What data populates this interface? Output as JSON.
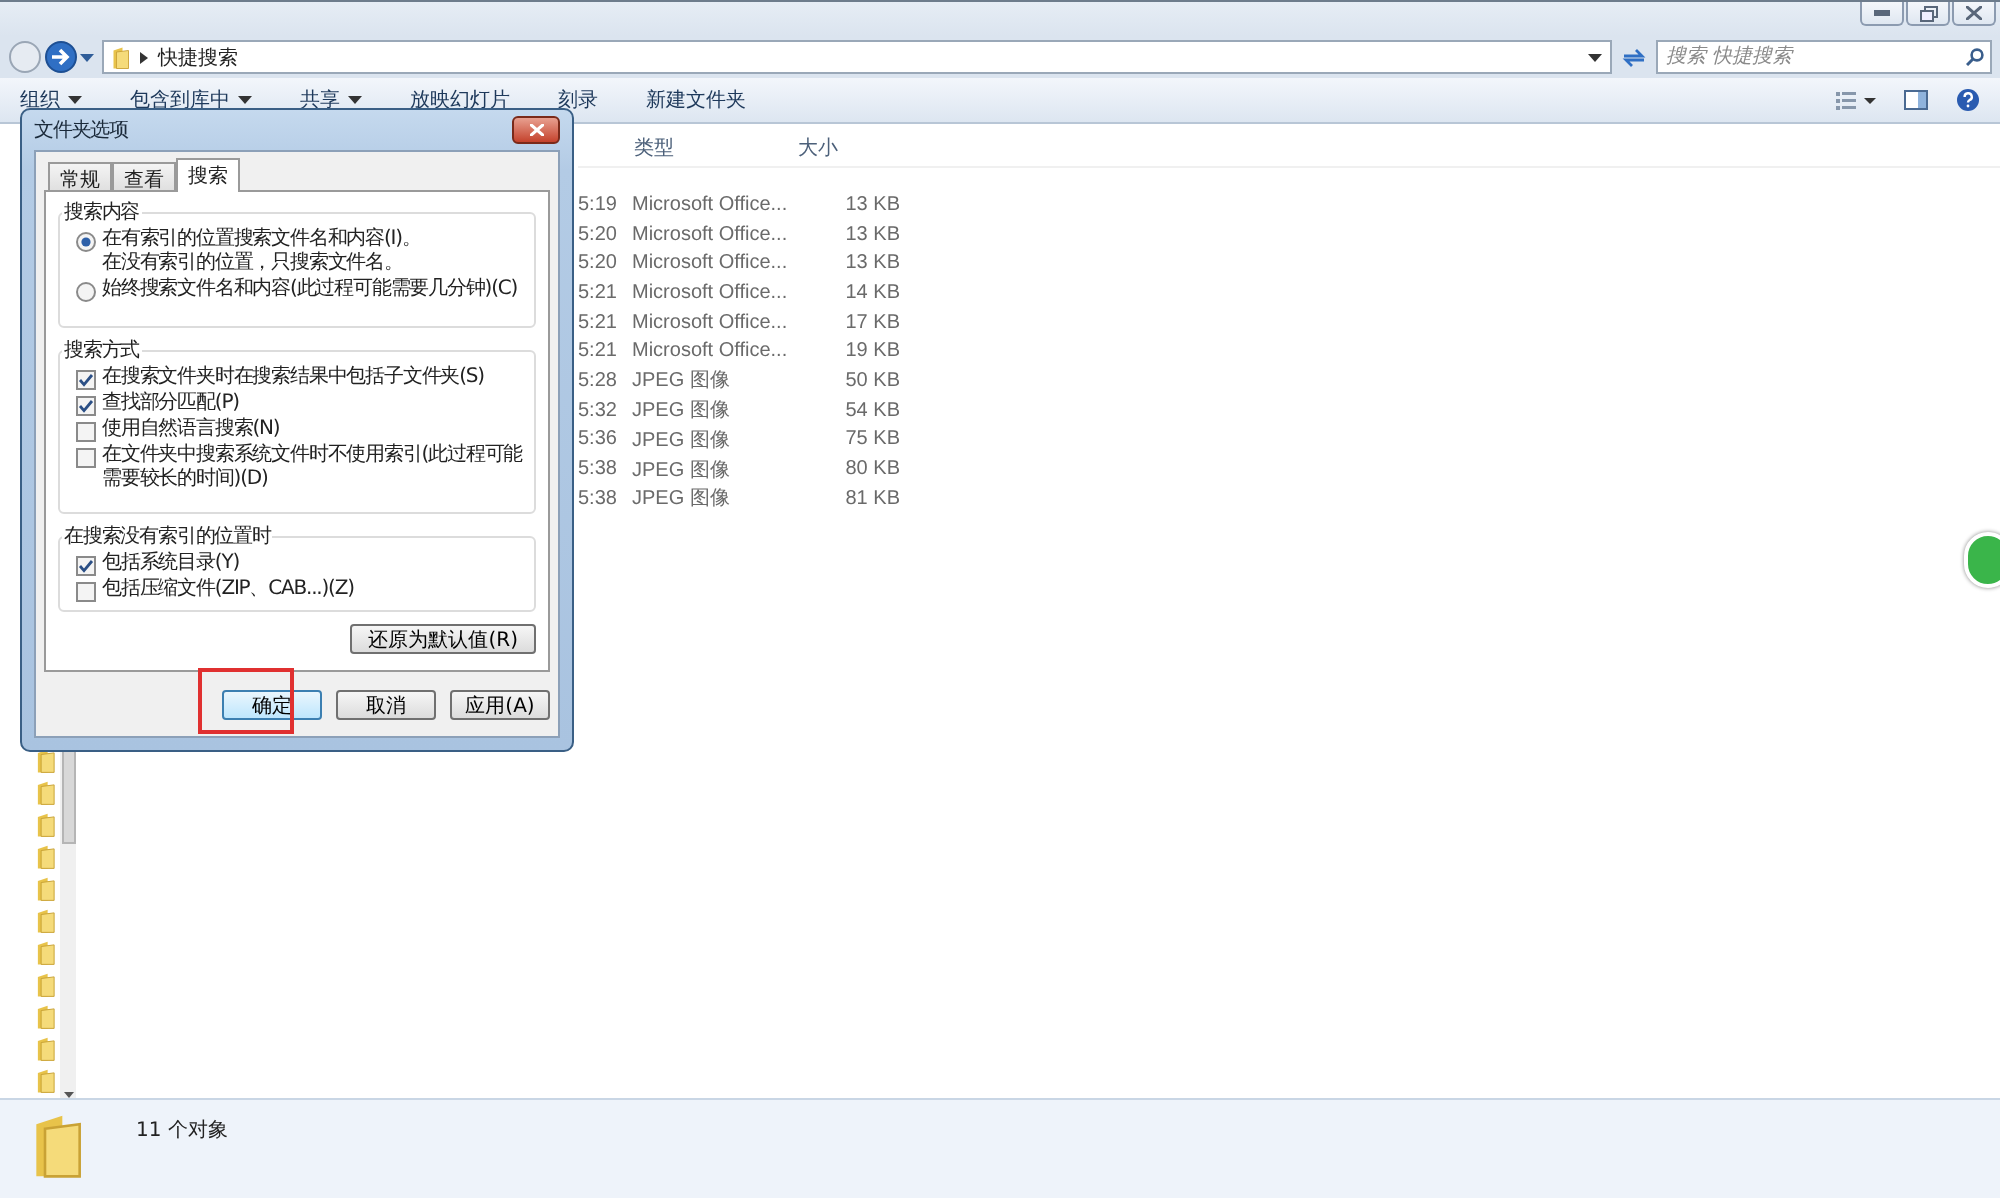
{
  "address": {
    "path": "快捷搜索"
  },
  "search": {
    "placeholder": "搜索 快捷搜索"
  },
  "toolbar": {
    "items": [
      {
        "label": "组织",
        "dropdown": true
      },
      {
        "label": "包含到库中",
        "dropdown": true
      },
      {
        "label": "共享",
        "dropdown": true
      },
      {
        "label": "放映幻灯片",
        "dropdown": false
      },
      {
        "label": "刻录",
        "dropdown": false
      },
      {
        "label": "新建文件夹",
        "dropdown": false
      }
    ]
  },
  "file_list": {
    "columns": [
      "类型",
      "大小"
    ],
    "rows": [
      {
        "column_1": "5:19",
        "type": "Microsoft Office...",
        "size": "13 KB"
      },
      {
        "column_1": "5:20",
        "type": "Microsoft Office...",
        "size": "13 KB"
      },
      {
        "column_1": "5:20",
        "type": "Microsoft Office...",
        "size": "13 KB"
      },
      {
        "column_1": "5:21",
        "type": "Microsoft Office...",
        "size": "14 KB"
      },
      {
        "column_1": "5:21",
        "type": "Microsoft Office...",
        "size": "17 KB"
      },
      {
        "column_1": "5:21",
        "type": "Microsoft Office...",
        "size": "19 KB"
      },
      {
        "column_1": "5:28",
        "type": "JPEG 图像",
        "size": "50 KB"
      },
      {
        "column_1": "5:32",
        "type": "JPEG 图像",
        "size": "54 KB"
      },
      {
        "column_1": "5:36",
        "type": "JPEG 图像",
        "size": "75 KB"
      },
      {
        "column_1": "5:38",
        "type": "JPEG 图像",
        "size": "80 KB"
      },
      {
        "column_1": "5:38",
        "type": "JPEG 图像",
        "size": "81 KB"
      }
    ]
  },
  "status_bar": {
    "count": "11 个对象"
  },
  "dialog": {
    "title": "文件夹选项",
    "tabs": [
      {
        "label": "常规",
        "selected": false
      },
      {
        "label": "查看",
        "selected": false
      },
      {
        "label": "搜索",
        "selected": true
      }
    ],
    "groups": [
      {
        "title": "搜索内容",
        "options": [
          {
            "kind": "radio",
            "label": "在有索引的位置搜索文件名和内容(I)。",
            "note": "在没有索引的位置，只搜索文件名。",
            "selected": true
          },
          {
            "kind": "radio",
            "label": "始终搜索文件名和内容(此过程可能需要几分钟)(C)",
            "selected": false
          }
        ]
      },
      {
        "title": "搜索方式",
        "options": [
          {
            "kind": "checkbox",
            "label": "在搜索文件夹时在搜索结果中包括子文件夹(S)",
            "checked": true
          },
          {
            "kind": "checkbox",
            "label": "查找部分匹配(P)",
            "checked": true
          },
          {
            "kind": "checkbox",
            "label": "使用自然语言搜索(N)",
            "checked": false
          },
          {
            "kind": "checkbox",
            "label": "在文件夹中搜索系统文件时不使用索引(此过程可能需要较长的时间)(D)",
            "checked": false
          }
        ]
      },
      {
        "title": "在搜索没有索引的位置时",
        "options": [
          {
            "kind": "checkbox",
            "label": "包括系统目录(Y)",
            "checked": true
          },
          {
            "kind": "checkbox",
            "label": "包括压缩文件(ZIP、CAB...)(Z)",
            "checked": false
          }
        ]
      }
    ],
    "restore_button": "还原为默认值(R)",
    "buttons": [
      {
        "label": "确定",
        "highlighted": true
      },
      {
        "label": "取消",
        "highlighted": false
      },
      {
        "label": "应用(A)",
        "highlighted": false
      }
    ]
  }
}
